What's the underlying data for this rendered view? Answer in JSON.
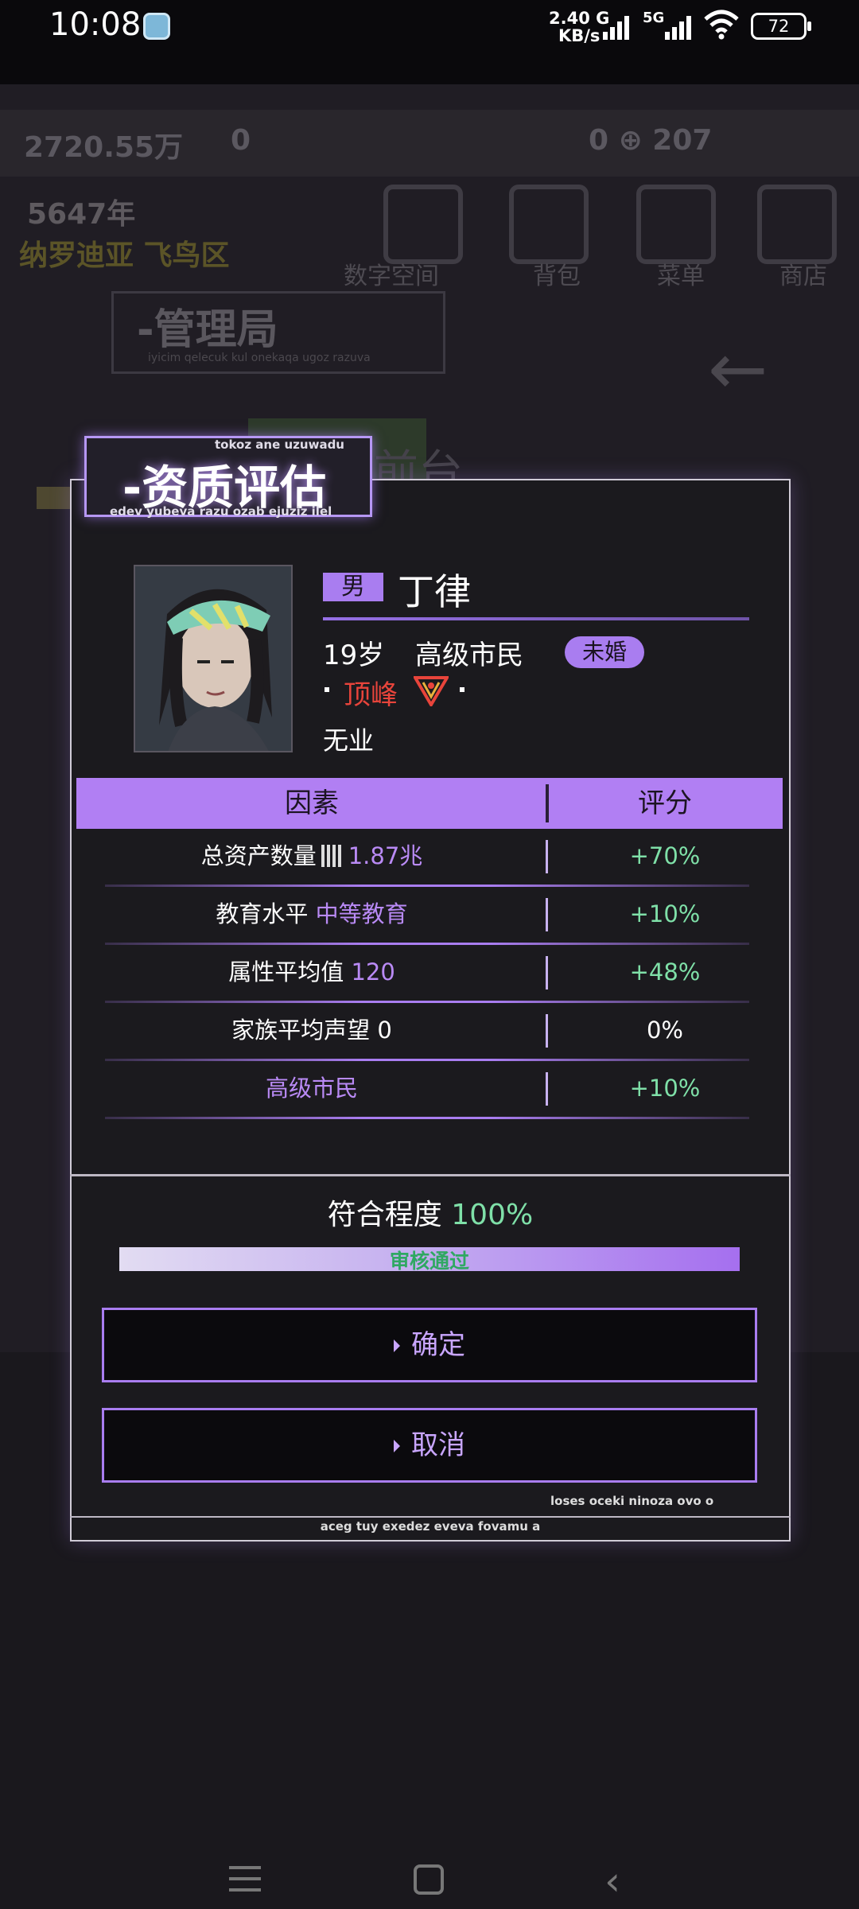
{
  "status_bar": {
    "time": "10:08",
    "net_speed_value": "2.40 G",
    "net_speed_unit": "KB/s",
    "network": "5G",
    "battery": "72",
    "app_icon": "notification-app-icon"
  },
  "background": {
    "currency": "2720.55万",
    "population": "0",
    "resources": "0 ⊕  207",
    "year": "5647年",
    "district": "纳罗迪亚 飞鸟区",
    "nav": [
      "数字空间",
      "背包",
      "菜单",
      "商店"
    ],
    "bureau_title": "-管理局",
    "bureau_sub": "iyicim qelecuk kul onekaqa ugoz razuva",
    "reception": "前台"
  },
  "dialog": {
    "title": "-资质评估",
    "title_top_caption": "tokoz ane uzuwadu",
    "title_bottom_caption": "edev yubeva razu ozab ejuziz ilel",
    "profile": {
      "gender": "男",
      "name": "丁律",
      "age": "19岁",
      "citizen_level": "高级市民",
      "marital_status": "未婚",
      "rank": "顶峰",
      "occupation": "无业"
    },
    "table": {
      "headers": {
        "factor": "因素",
        "score": "评分"
      },
      "rows": [
        {
          "label": "总资产数量",
          "value": "1.87兆",
          "score": "+70%"
        },
        {
          "label": "教育水平",
          "value": "中等教育",
          "score": "+10%"
        },
        {
          "label": "属性平均值",
          "value": "120",
          "score": "+48%"
        },
        {
          "label": "家族平均声望",
          "value": "0",
          "score": "0%"
        },
        {
          "label": "",
          "value": "高级市民",
          "score": "+10%"
        }
      ]
    },
    "match_label": "符合程度",
    "match_value": "100%",
    "match_progress": 1.0,
    "progress_label": "审核通过",
    "confirm_label": "确定",
    "cancel_label": "取消",
    "footer_caption_1": "loses oceki ninoza ovo o",
    "footer_caption_2": "aceg tuy exedez eveva fovamu a"
  },
  "colors": {
    "accent": "#a97df0",
    "positive": "#7fe0a8",
    "rank_red": "#e8443b",
    "panel_bg": "#1b1a1e"
  }
}
